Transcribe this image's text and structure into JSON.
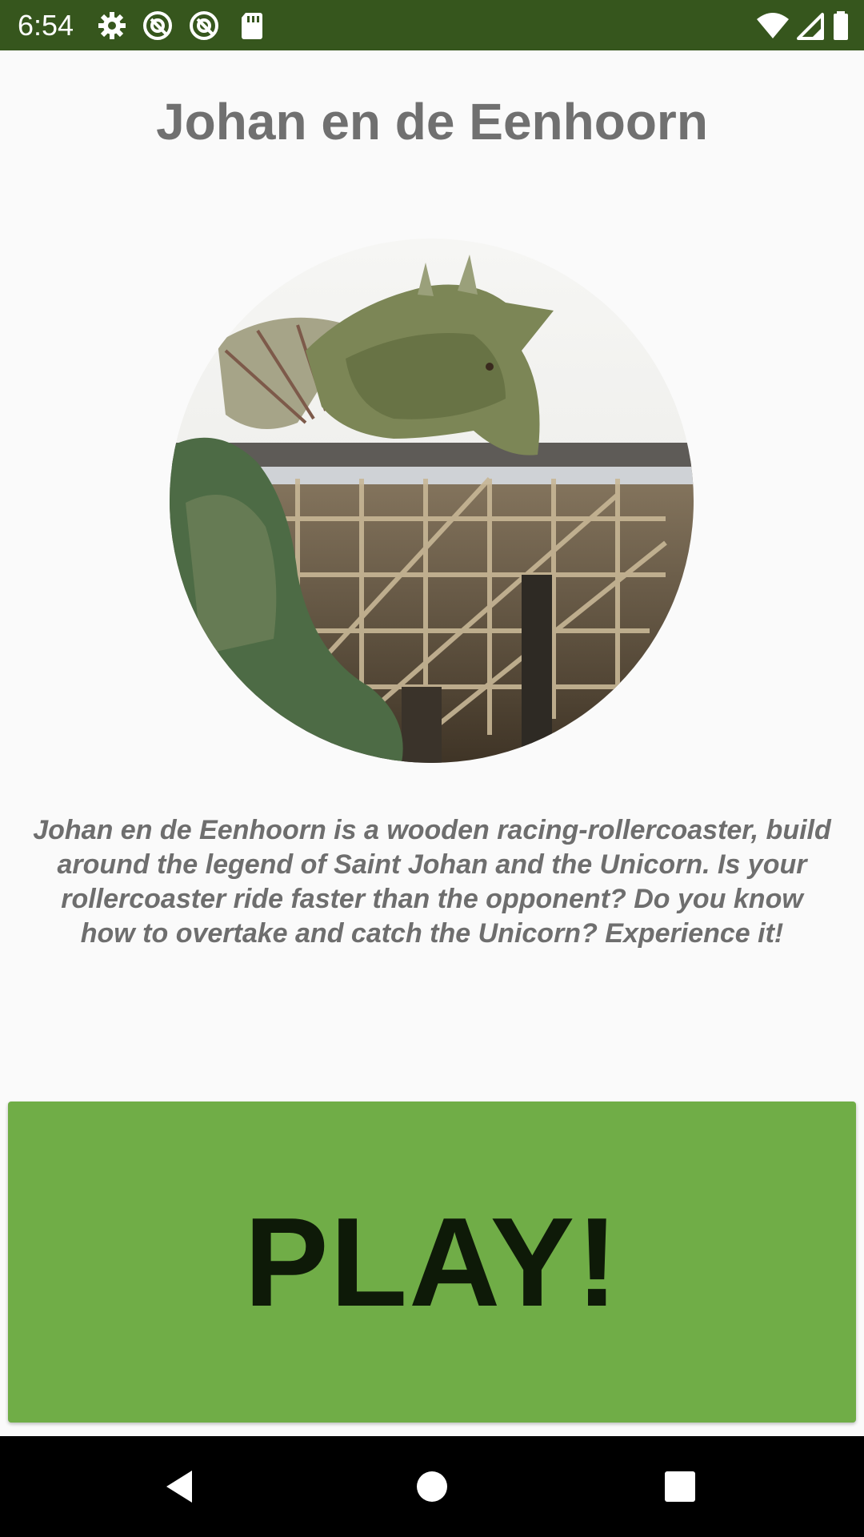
{
  "status_bar": {
    "time": "6:54",
    "left_icons": [
      "gear-icon",
      "at-sign-icon",
      "at-sign-icon",
      "sd-card-icon"
    ],
    "right_icons": [
      "wifi-icon",
      "signal-icon",
      "battery-icon"
    ],
    "background_color": "#36561d"
  },
  "main": {
    "title": "Johan en de Eenhoorn",
    "image_description_icon": "ride-photo",
    "description": "Johan en de Eenhoorn is a wooden racing-rollercoaster, build around the legend of Saint Johan and the Unicorn. Is your rollercoaster ride faster than the opponent? Do you know how to overtake and catch the Unicorn? Experience it!",
    "play_label": "PLAY!",
    "play_color": "#70ad47"
  },
  "nav_bar": {
    "buttons": [
      "back-icon",
      "home-icon",
      "recents-icon"
    ]
  }
}
